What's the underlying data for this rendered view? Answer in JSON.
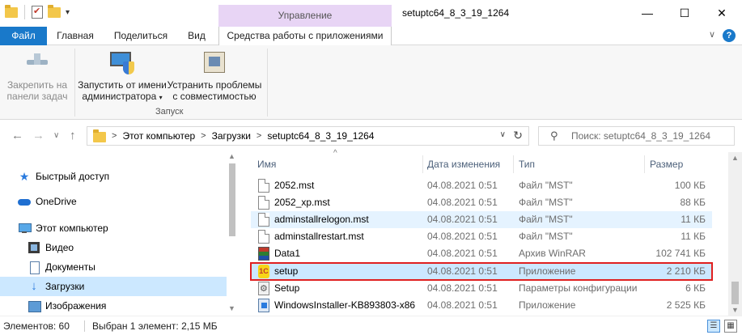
{
  "titlebar": {
    "context_tab_header": "Управление",
    "window_title": "setuptc64_8_3_19_1264",
    "minimize": "—",
    "maximize": "☐",
    "close": "✕"
  },
  "tabs": {
    "file": "Файл",
    "home": "Главная",
    "share": "Поделиться",
    "view": "Вид",
    "app_tools": "Средства работы с приложениями",
    "collapse": "∨"
  },
  "ribbon": {
    "pin_line1": "Закрепить на",
    "pin_line2": "панели задач",
    "run_admin_line1": "Запустить от имени",
    "run_admin_line2": "администратора",
    "troubleshoot_line1": "Устранить проблемы",
    "troubleshoot_line2": "с совместимостью",
    "group_label": "Запуск"
  },
  "nav": {
    "back": "←",
    "forward": "→",
    "recent": "∨",
    "up": "↑"
  },
  "address": {
    "crumbs": [
      "Этот компьютер",
      "Загрузки",
      "setuptc64_8_3_19_1264"
    ],
    "separator": ">",
    "dropdown": "∨",
    "refresh": "↻"
  },
  "search": {
    "icon": "search-icon",
    "placeholder": "Поиск: setuptc64_8_3_19_1264"
  },
  "navpane": {
    "quick_access": "Быстрый доступ",
    "onedrive": "OneDrive",
    "this_pc": "Этот компьютер",
    "videos": "Видео",
    "documents": "Документы",
    "downloads": "Загрузки",
    "images": "Изображения"
  },
  "columns": {
    "sort_indicator": "^",
    "name": "Имя",
    "date": "Дата изменения",
    "type": "Тип",
    "size": "Размер"
  },
  "files": [
    {
      "name": "2052.mst",
      "date": "04.08.2021 0:51",
      "type": "Файл \"MST\"",
      "size": "100 КБ",
      "icon": "mst"
    },
    {
      "name": "2052_xp.mst",
      "date": "04.08.2021 0:51",
      "type": "Файл \"MST\"",
      "size": "88 КБ",
      "icon": "mst"
    },
    {
      "name": "adminstallrelogon.mst",
      "date": "04.08.2021 0:51",
      "type": "Файл \"MST\"",
      "size": "11 КБ",
      "icon": "mst"
    },
    {
      "name": "adminstallrestart.mst",
      "date": "04.08.2021 0:51",
      "type": "Файл \"MST\"",
      "size": "11 КБ",
      "icon": "mst"
    },
    {
      "name": "Data1",
      "date": "04.08.2021 0:51",
      "type": "Архив WinRAR",
      "size": "102 741 КБ",
      "icon": "rar"
    },
    {
      "name": "setup",
      "date": "04.08.2021 0:51",
      "type": "Приложение",
      "size": "2 210 КБ",
      "icon": "onec"
    },
    {
      "name": "Setup",
      "date": "04.08.2021 0:51",
      "type": "Параметры конфигурации",
      "size": "6 КБ",
      "icon": "cfg"
    },
    {
      "name": "WindowsInstaller-KB893803-x86",
      "date": "04.08.2021 0:51",
      "type": "Приложение",
      "size": "2 525 КБ",
      "icon": "msi"
    }
  ],
  "status": {
    "count": "Элементов: 60",
    "selection": "Выбран 1 элемент: 2,15 МБ"
  }
}
